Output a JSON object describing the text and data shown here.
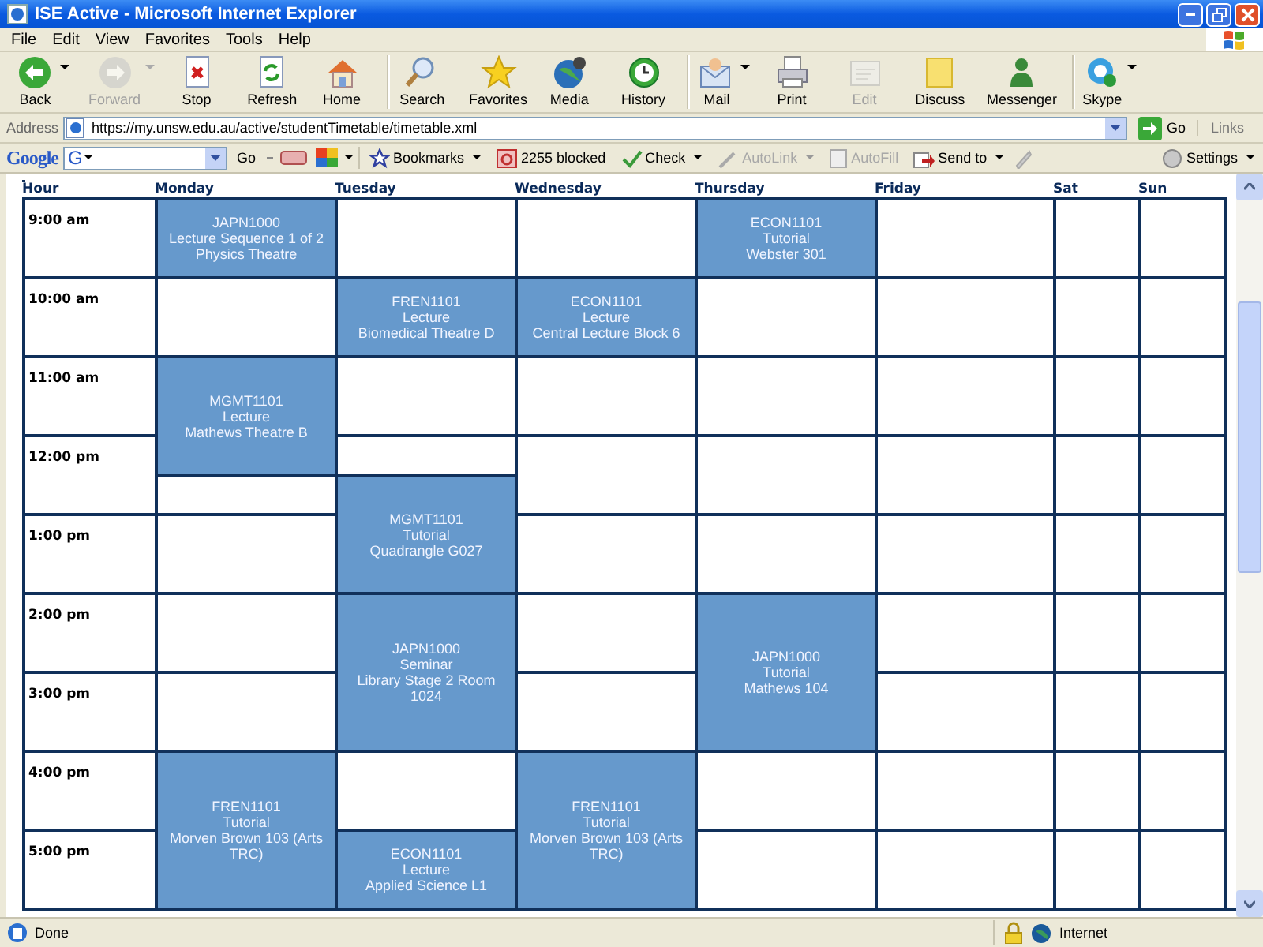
{
  "window": {
    "title": "ISE Active - Microsoft Internet Explorer"
  },
  "menu": [
    "File",
    "Edit",
    "View",
    "Favorites",
    "Tools",
    "Help"
  ],
  "toolbar": [
    {
      "kind": "back",
      "label": "Back",
      "disabled": false,
      "dropdown": true,
      "separator_before": false
    },
    {
      "kind": "forward",
      "label": "Forward",
      "disabled": true,
      "dropdown": true,
      "separator_before": false
    },
    {
      "kind": "stop",
      "label": "Stop",
      "disabled": false,
      "dropdown": false,
      "separator_before": false
    },
    {
      "kind": "refresh",
      "label": "Refresh",
      "disabled": false,
      "dropdown": false,
      "separator_before": false
    },
    {
      "kind": "home",
      "label": "Home",
      "disabled": false,
      "dropdown": false,
      "separator_before": false
    },
    {
      "kind": "search",
      "label": "Search",
      "disabled": false,
      "dropdown": false,
      "separator_before": true
    },
    {
      "kind": "favorites",
      "label": "Favorites",
      "disabled": false,
      "dropdown": false,
      "separator_before": false
    },
    {
      "kind": "media",
      "label": "Media",
      "disabled": false,
      "dropdown": false,
      "separator_before": false
    },
    {
      "kind": "history",
      "label": "History",
      "disabled": false,
      "dropdown": false,
      "separator_before": false
    },
    {
      "kind": "mail",
      "label": "Mail",
      "disabled": false,
      "dropdown": true,
      "separator_before": true
    },
    {
      "kind": "print",
      "label": "Print",
      "disabled": false,
      "dropdown": false,
      "separator_before": false
    },
    {
      "kind": "edit",
      "label": "Edit",
      "disabled": true,
      "dropdown": false,
      "separator_before": false
    },
    {
      "kind": "discuss",
      "label": "Discuss",
      "disabled": false,
      "dropdown": false,
      "separator_before": false
    },
    {
      "kind": "messenger",
      "label": "Messenger",
      "disabled": false,
      "dropdown": false,
      "separator_before": false
    },
    {
      "kind": "skype",
      "label": "Skype",
      "disabled": false,
      "dropdown": true,
      "separator_before": true
    }
  ],
  "address": {
    "label": "Address",
    "url": "https://my.unsw.edu.au/active/studentTimetable/timetable.xml",
    "go": "Go",
    "links": "Links"
  },
  "google_bar": {
    "logo": "Google",
    "search_label": "G",
    "go": "Go",
    "items": [
      {
        "kind": "bookmarks",
        "label": "Bookmarks",
        "disabled": false
      },
      {
        "kind": "blocked",
        "label": "2255 blocked",
        "disabled": false
      },
      {
        "kind": "check",
        "label": "Check",
        "disabled": false
      },
      {
        "kind": "autolink",
        "label": "AutoLink",
        "disabled": true
      },
      {
        "kind": "autofill",
        "label": "AutoFill",
        "disabled": true
      },
      {
        "kind": "sendto",
        "label": "Send to",
        "disabled": false
      }
    ],
    "settings": "Settings"
  },
  "timetable": {
    "columns": [
      "Hour",
      "Monday",
      "Tuesday",
      "Wednesday",
      "Thursday",
      "Friday",
      "Sat",
      "Sun"
    ],
    "hours": [
      "9:00 am",
      "10:00 am",
      "11:00 am",
      "12:00 pm",
      "1:00 pm",
      "2:00 pm",
      "3:00 pm",
      "4:00 pm",
      "5:00 pm"
    ],
    "days": [
      {
        "cells": [
          {
            "kind": "single",
            "booked": true,
            "code": "JAPN1000",
            "type": "Lecture Sequence 1 of 2",
            "room": "Physics Theatre"
          },
          {
            "kind": "single",
            "booked": false
          },
          {
            "kind": "sesqui",
            "booked": true,
            "code": "MGMT1101",
            "type": "Lecture",
            "room": "Mathews Theatre B"
          },
          {
            "kind": "half",
            "booked": false
          },
          {
            "kind": "single",
            "booked": false
          },
          {
            "kind": "single",
            "booked": false
          },
          {
            "kind": "single",
            "booked": false
          },
          {
            "kind": "double",
            "booked": true,
            "code": "FREN1101",
            "type": "Tutorial",
            "room": "Morven Brown 103 (Arts TRC)"
          }
        ]
      },
      {
        "cells": [
          {
            "kind": "single",
            "booked": false
          },
          {
            "kind": "single",
            "booked": true,
            "code": "FREN1101",
            "type": "Lecture",
            "room": "Biomedical Theatre D"
          },
          {
            "kind": "single",
            "booked": false
          },
          {
            "kind": "half",
            "booked": false
          },
          {
            "kind": "sesqui",
            "booked": true,
            "code": "MGMT1101",
            "type": "Tutorial",
            "room": "Quadrangle G027"
          },
          {
            "kind": "double",
            "booked": true,
            "code": "JAPN1000",
            "type": "Seminar",
            "room": "Library Stage 2 Room 1024"
          },
          {
            "kind": "single",
            "booked": false
          },
          {
            "kind": "single",
            "booked": true,
            "code": "ECON1101",
            "type": "Lecture",
            "room": "Applied Science L1"
          }
        ]
      },
      {
        "cells": [
          {
            "kind": "single",
            "booked": false
          },
          {
            "kind": "single",
            "booked": true,
            "code": "ECON1101",
            "type": "Lecture",
            "room": "Central Lecture Block 6"
          },
          {
            "kind": "single",
            "booked": false
          },
          {
            "kind": "single",
            "booked": false
          },
          {
            "kind": "single",
            "booked": false
          },
          {
            "kind": "single",
            "booked": false
          },
          {
            "kind": "single",
            "booked": false
          },
          {
            "kind": "double",
            "booked": true,
            "code": "FREN1101",
            "type": "Tutorial",
            "room": "Morven Brown 103 (Arts TRC)"
          }
        ]
      },
      {
        "cells": [
          {
            "kind": "single",
            "booked": true,
            "code": "ECON1101",
            "type": "Tutorial",
            "room": "Webster 301"
          },
          {
            "kind": "single",
            "booked": false
          },
          {
            "kind": "single",
            "booked": false
          },
          {
            "kind": "single",
            "booked": false
          },
          {
            "kind": "single",
            "booked": false
          },
          {
            "kind": "double",
            "booked": true,
            "code": "JAPN1000",
            "type": "Tutorial",
            "room": "Mathews 104"
          },
          {
            "kind": "single",
            "booked": false
          },
          {
            "kind": "single",
            "booked": false
          }
        ]
      },
      {
        "cells": [
          {
            "kind": "single",
            "booked": false
          },
          {
            "kind": "single",
            "booked": false
          },
          {
            "kind": "single",
            "booked": false
          },
          {
            "kind": "single",
            "booked": false
          },
          {
            "kind": "single",
            "booked": false
          },
          {
            "kind": "single",
            "booked": false
          },
          {
            "kind": "single",
            "booked": false
          },
          {
            "kind": "single",
            "booked": false
          },
          {
            "kind": "single",
            "booked": false
          }
        ]
      },
      {
        "cells": [
          {
            "kind": "single",
            "booked": false
          },
          {
            "kind": "single",
            "booked": false
          },
          {
            "kind": "single",
            "booked": false
          },
          {
            "kind": "single",
            "booked": false
          },
          {
            "kind": "single",
            "booked": false
          },
          {
            "kind": "single",
            "booked": false
          },
          {
            "kind": "single",
            "booked": false
          },
          {
            "kind": "single",
            "booked": false
          },
          {
            "kind": "single",
            "booked": false
          }
        ]
      },
      {
        "cells": [
          {
            "kind": "single",
            "booked": false
          },
          {
            "kind": "single",
            "booked": false
          },
          {
            "kind": "single",
            "booked": false
          },
          {
            "kind": "single",
            "booked": false
          },
          {
            "kind": "single",
            "booked": false
          },
          {
            "kind": "single",
            "booked": false
          },
          {
            "kind": "single",
            "booked": false
          },
          {
            "kind": "single",
            "booked": false
          },
          {
            "kind": "single",
            "booked": false
          }
        ]
      }
    ]
  },
  "status_bar": {
    "text": "Done",
    "zone": "Internet"
  }
}
